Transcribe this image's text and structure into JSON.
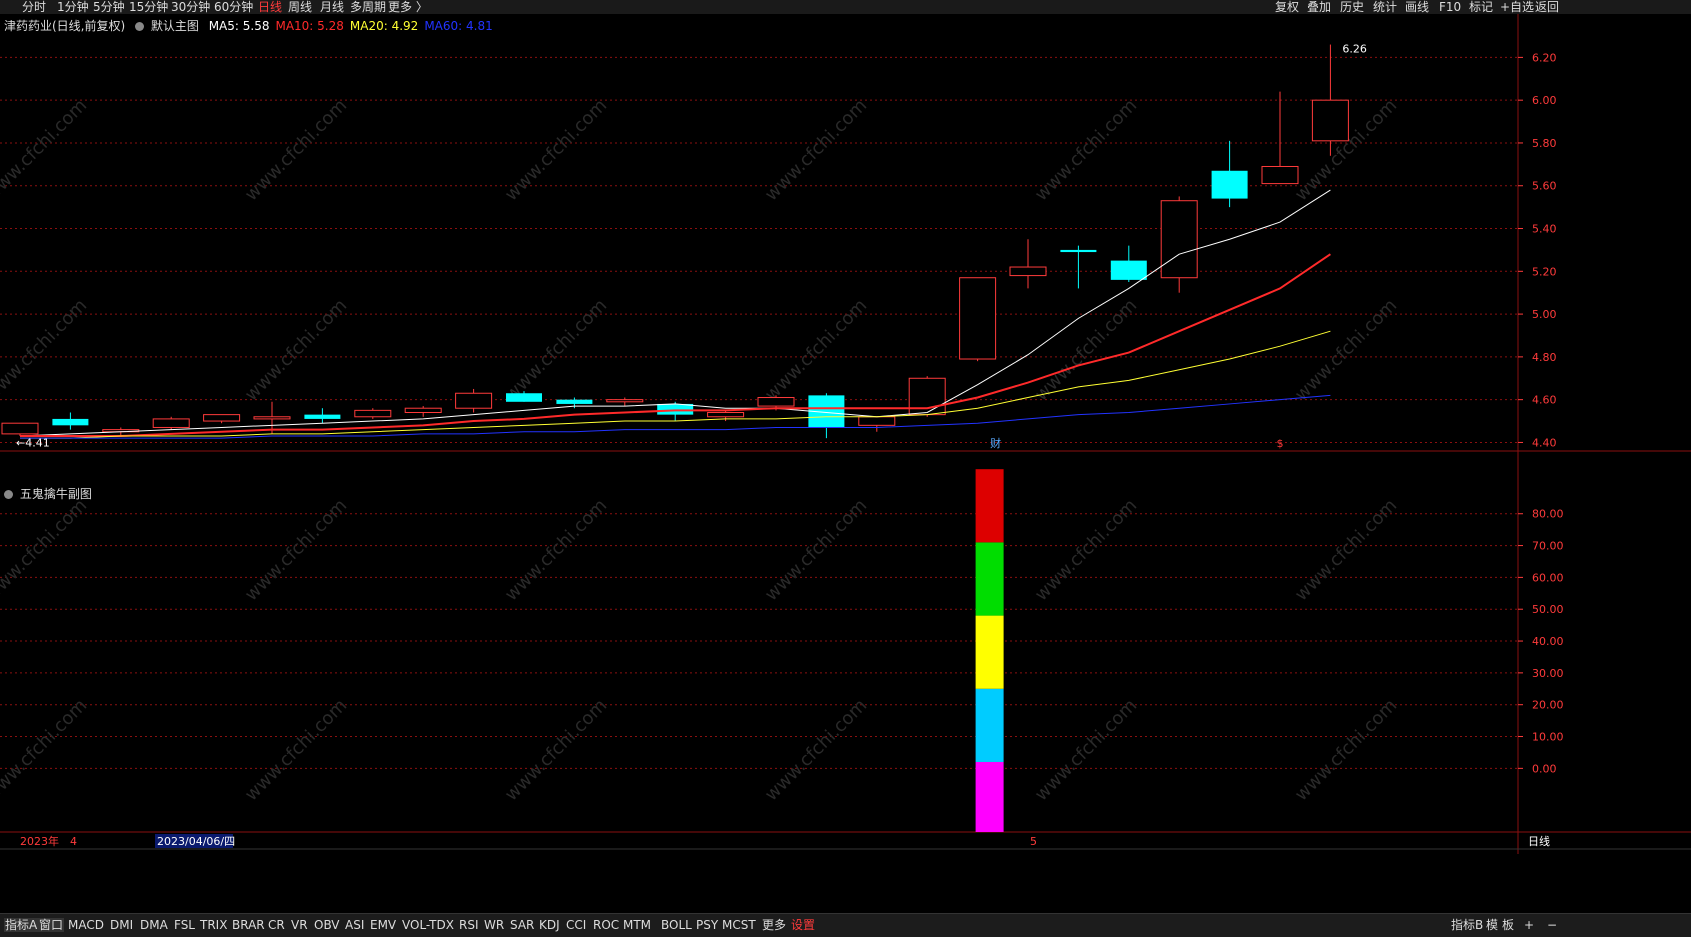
{
  "toolbar": {
    "left_items": [
      "分时",
      "1分钟",
      "5分钟",
      "15分钟",
      "30分钟",
      "60分钟",
      "日线",
      "周线",
      "月线",
      "多周期",
      "更多 〉"
    ],
    "active": "日线",
    "right_items": [
      "复权",
      "叠加",
      "历史",
      "统计",
      "画线",
      "F10",
      "标记",
      "+自选",
      "返回"
    ]
  },
  "main_header": {
    "stock": "津药药业(日线,前复权)",
    "indicator": "默认主图",
    "ma": [
      {
        "label": "MA5: 5.58",
        "color": "#ffffff"
      },
      {
        "label": "MA10: 5.28",
        "color": "#ff2a2a"
      },
      {
        "label": "MA20: 4.92",
        "color": "#ffff33"
      },
      {
        "label": "MA60: 4.81",
        "color": "#2233ff"
      }
    ]
  },
  "sub_header": {
    "title": "五鬼擒牛副图"
  },
  "colors": {
    "up": "#ff3b3b",
    "down": "#00ffff",
    "grid": "#8a1010",
    "axis": "#ff3b3b"
  },
  "chart_data": [
    {
      "type": "candlestick",
      "ylim": [
        4.36,
        6.3
      ],
      "y_ticks": [
        "6.20",
        "6.00",
        "5.80",
        "5.60",
        "5.40",
        "5.20",
        "5.00",
        "4.80",
        "4.60",
        "4.40"
      ],
      "ohlc": [
        [
          4.44,
          4.49,
          4.43,
          4.49
        ],
        [
          4.51,
          4.54,
          4.46,
          4.48
        ],
        [
          4.45,
          4.47,
          4.43,
          4.46
        ],
        [
          4.47,
          4.52,
          4.46,
          4.51
        ],
        [
          4.5,
          4.53,
          4.49,
          4.53
        ],
        [
          4.51,
          4.59,
          4.44,
          4.52
        ],
        [
          4.53,
          4.56,
          4.49,
          4.51
        ],
        [
          4.52,
          4.56,
          4.51,
          4.55
        ],
        [
          4.54,
          4.57,
          4.52,
          4.56
        ],
        [
          4.56,
          4.65,
          4.54,
          4.63
        ],
        [
          4.63,
          4.64,
          4.59,
          4.59
        ],
        [
          4.6,
          4.61,
          4.56,
          4.58
        ],
        [
          4.59,
          4.61,
          4.57,
          4.6
        ],
        [
          4.58,
          4.59,
          4.5,
          4.53
        ],
        [
          4.52,
          4.55,
          4.5,
          4.54
        ],
        [
          4.57,
          4.62,
          4.55,
          4.61
        ],
        [
          4.62,
          4.63,
          4.42,
          4.47
        ],
        [
          4.48,
          4.52,
          4.45,
          4.52
        ],
        [
          4.53,
          4.71,
          4.52,
          4.7
        ],
        [
          4.79,
          5.17,
          4.78,
          5.17
        ],
        [
          5.18,
          5.35,
          5.12,
          5.22
        ],
        [
          5.3,
          5.32,
          5.12,
          5.29
        ],
        [
          5.25,
          5.32,
          5.15,
          5.16
        ],
        [
          5.17,
          5.55,
          5.1,
          5.53
        ],
        [
          5.67,
          5.81,
          5.5,
          5.54
        ],
        [
          5.61,
          6.04,
          5.61,
          5.69
        ],
        [
          5.81,
          6.26,
          5.74,
          6.0
        ]
      ],
      "ma_lines": [
        {
          "name": "MA5",
          "color": "#ffffff",
          "values": [
            4.43,
            4.44,
            4.45,
            4.46,
            4.47,
            4.48,
            4.49,
            4.5,
            4.51,
            4.53,
            4.55,
            4.57,
            4.57,
            4.58,
            4.56,
            4.56,
            4.54,
            4.52,
            4.54,
            4.67,
            4.81,
            4.98,
            5.12,
            5.28,
            5.35,
            5.43,
            5.58
          ]
        },
        {
          "name": "MA10",
          "color": "#ff2a2a",
          "values": [
            4.43,
            4.43,
            4.43,
            4.44,
            4.45,
            4.46,
            4.46,
            4.47,
            4.48,
            4.5,
            4.51,
            4.53,
            4.54,
            4.55,
            4.55,
            4.56,
            4.56,
            4.56,
            4.56,
            4.61,
            4.68,
            4.76,
            4.82,
            4.92,
            5.02,
            5.12,
            5.28
          ]
        },
        {
          "name": "MA20",
          "color": "#ffff33",
          "values": [
            4.42,
            4.42,
            4.43,
            4.43,
            4.43,
            4.44,
            4.44,
            4.45,
            4.46,
            4.47,
            4.48,
            4.49,
            4.5,
            4.5,
            4.51,
            4.51,
            4.52,
            4.52,
            4.53,
            4.56,
            4.61,
            4.66,
            4.69,
            4.74,
            4.79,
            4.85,
            4.92
          ]
        },
        {
          "name": "MA60",
          "color": "#2233ff",
          "values": [
            4.42,
            4.42,
            4.42,
            4.42,
            4.42,
            4.43,
            4.43,
            4.43,
            4.44,
            4.44,
            4.45,
            4.45,
            4.46,
            4.46,
            4.46,
            4.47,
            4.47,
            4.47,
            4.48,
            4.49,
            4.51,
            4.53,
            4.54,
            4.56,
            4.58,
            4.6,
            4.62
          ]
        }
      ],
      "annotations": {
        "high_label": "6.26",
        "low_label": "←4.41",
        "finance_mark": "财",
        "dollar_mark": "$"
      }
    },
    {
      "type": "bar",
      "ylim": [
        -20,
        95
      ],
      "y_ticks": [
        "80.00",
        "70.00",
        "60.00",
        "50.00",
        "40.00",
        "30.00",
        "20.00",
        "10.00",
        "0.00"
      ],
      "bar_index": 19,
      "segments": [
        {
          "from": -20,
          "to": 2,
          "color": "#ff00ff"
        },
        {
          "from": 2,
          "to": 25,
          "color": "#00ccff"
        },
        {
          "from": 25,
          "to": 48,
          "color": "#ffff00"
        },
        {
          "from": 48,
          "to": 71,
          "color": "#00dd00"
        },
        {
          "from": 71,
          "to": 94,
          "color": "#dd0000"
        }
      ]
    }
  ],
  "date_axis": {
    "year": "2023年",
    "month1": "4",
    "cursor_date": "2023/04/06/四",
    "month2": "5",
    "period": "日线"
  },
  "bottom": {
    "tabs": [
      "指标A",
      "窗口",
      "MACD",
      "DMI",
      "DMA",
      "FSL",
      "TRIX",
      "BRAR",
      "CR",
      "VR",
      "OBV",
      "ASI",
      "EMV",
      "VOL-TDX",
      "RSI",
      "WR",
      "SAR",
      "KDJ",
      "CCI",
      "ROC",
      "MTM",
      "BOLL",
      "PSY",
      "MCST",
      "更多",
      "设置"
    ],
    "right": [
      "指标B",
      "模",
      "板",
      "+",
      "−"
    ]
  },
  "watermark": "www.cfchi.com"
}
